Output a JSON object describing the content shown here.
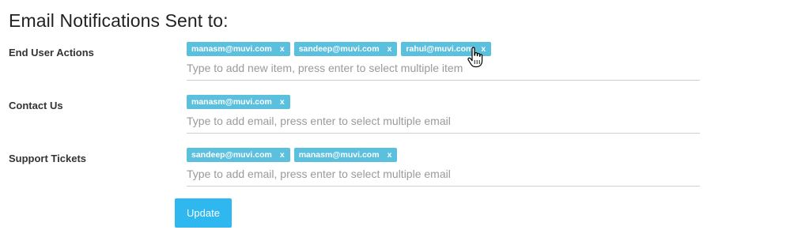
{
  "page": {
    "title": "Email Notifications Sent to:"
  },
  "rows": [
    {
      "label": "End User Actions",
      "tags": [
        "manasm@muvi.com",
        "sandeep@muvi.com",
        "rahul@muvi.com"
      ],
      "placeholder": "Type to add new item, press enter to select multiple item",
      "value": ""
    },
    {
      "label": "Contact Us",
      "tags": [
        "manasm@muvi.com"
      ],
      "placeholder": "Type to add email, press enter to select multiple email",
      "value": ""
    },
    {
      "label": "Support Tickets",
      "tags": [
        "sandeep@muvi.com",
        "manasm@muvi.com"
      ],
      "placeholder": "Type to add email, press enter to select multiple email",
      "value": ""
    }
  ],
  "tag_remove_symbol": "x",
  "update_button": {
    "label": "Update"
  },
  "colors": {
    "tag_bg": "#5bc0de",
    "button_bg": "#2fb7f0",
    "text": "#333333",
    "placeholder": "#9a9a9a",
    "underline": "#cfcfcf"
  },
  "cursor": {
    "icon": "hand-pointer-icon"
  }
}
